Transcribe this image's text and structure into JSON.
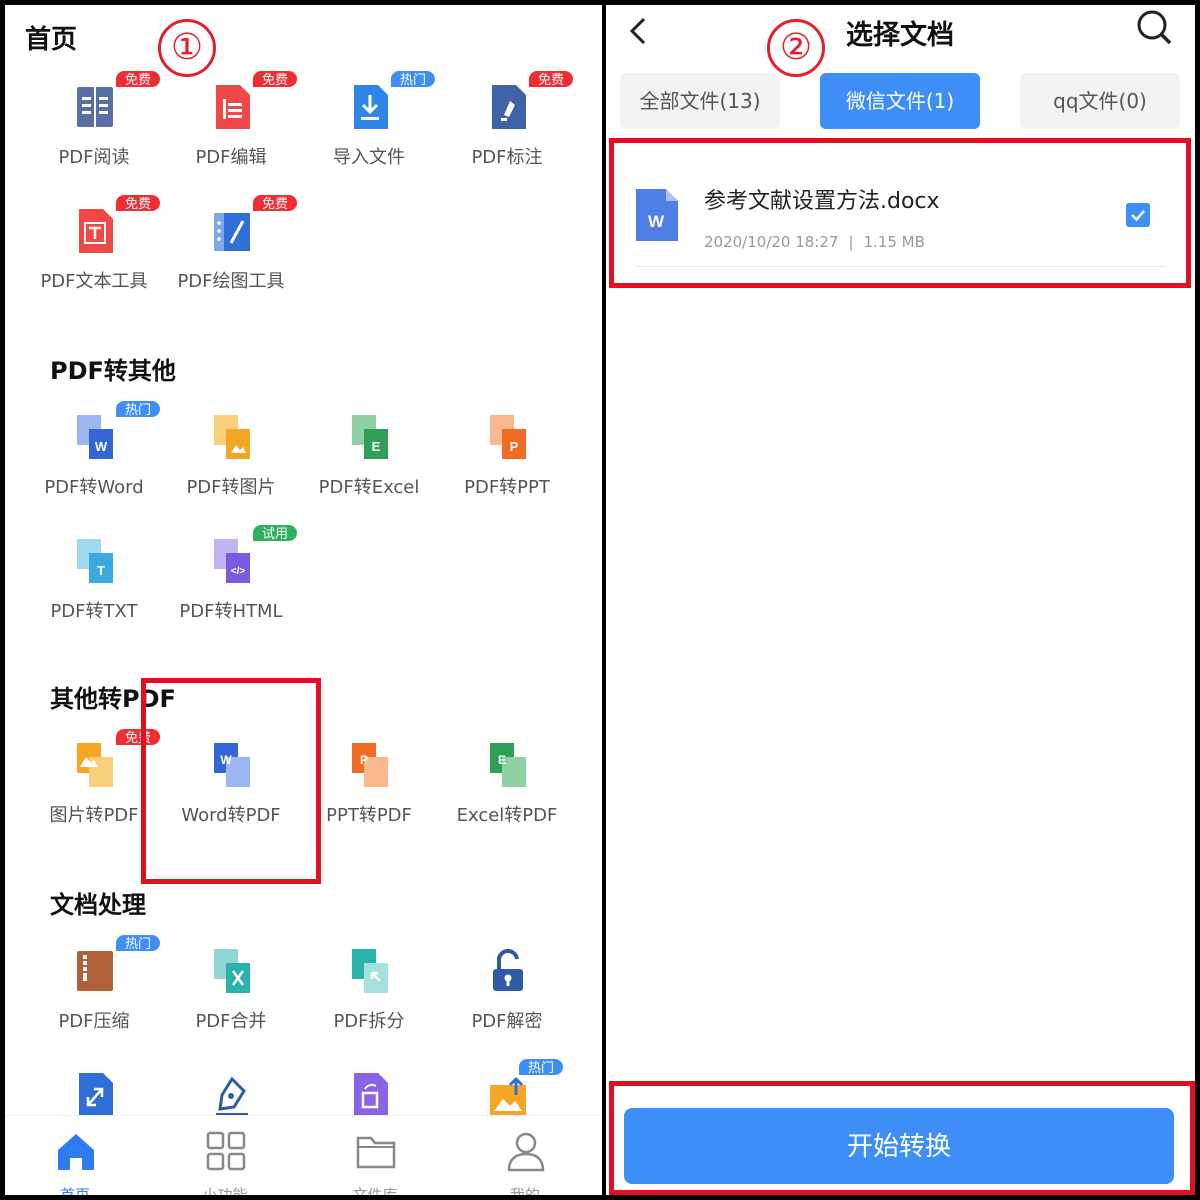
{
  "home": {
    "title": "首页",
    "step_marker": "①",
    "tools": [
      {
        "label": "PDF阅读",
        "icon": "pdf-read-icon",
        "badge": "免费"
      },
      {
        "label": "PDF编辑",
        "icon": "pdf-edit-icon",
        "badge": "免费"
      },
      {
        "label": "导入文件",
        "icon": "import-file-icon",
        "badge": "热门"
      },
      {
        "label": "PDF标注",
        "icon": "pdf-annotate-icon",
        "badge": "免费"
      },
      {
        "label": "PDF文本工具",
        "icon": "pdf-text-tool-icon",
        "badge": "免费"
      },
      {
        "label": "PDF绘图工具",
        "icon": "pdf-draw-tool-icon",
        "badge": "免费"
      }
    ],
    "sections": [
      {
        "title": "PDF转其他",
        "items": [
          {
            "label": "PDF转Word",
            "icon": "pdf-to-word-icon",
            "badge": "热门"
          },
          {
            "label": "PDF转图片",
            "icon": "pdf-to-image-icon"
          },
          {
            "label": "PDF转Excel",
            "icon": "pdf-to-excel-icon"
          },
          {
            "label": "PDF转PPT",
            "icon": "pdf-to-ppt-icon"
          },
          {
            "label": "PDF转TXT",
            "icon": "pdf-to-txt-icon"
          },
          {
            "label": "PDF转HTML",
            "icon": "pdf-to-html-icon",
            "badge": "试用"
          }
        ]
      },
      {
        "title": "其他转PDF",
        "items": [
          {
            "label": "图片转PDF",
            "icon": "image-to-pdf-icon",
            "badge": "免费"
          },
          {
            "label": "Word转PDF",
            "icon": "word-to-pdf-icon"
          },
          {
            "label": "PPT转PDF",
            "icon": "ppt-to-pdf-icon"
          },
          {
            "label": "Excel转PDF",
            "icon": "excel-to-pdf-icon"
          }
        ]
      },
      {
        "title": "文档处理",
        "items": [
          {
            "label": "PDF压缩",
            "icon": "pdf-compress-icon",
            "badge": "热门"
          },
          {
            "label": "PDF合并",
            "icon": "pdf-merge-icon"
          },
          {
            "label": "PDF拆分",
            "icon": "pdf-split-icon"
          },
          {
            "label": "PDF解密",
            "icon": "pdf-decrypt-icon"
          }
        ]
      }
    ],
    "bottom_nav": [
      {
        "label": "首页",
        "icon": "home-icon",
        "active": true
      },
      {
        "label": "小功能",
        "icon": "grid-icon"
      },
      {
        "label": "文件库",
        "icon": "folder-icon"
      },
      {
        "label": "我的",
        "icon": "user-icon"
      }
    ]
  },
  "select_doc": {
    "title": "选择文档",
    "step_marker": "②",
    "tabs": [
      {
        "label": "全部文件(13)"
      },
      {
        "label": "微信文件(1)",
        "active": true
      },
      {
        "label": "qq文件(0)"
      }
    ],
    "file": {
      "name": "参考文献设置方法.docx",
      "date": "2020/10/20 18:27",
      "separator": "|",
      "size": "1.15 MB",
      "checked": true
    },
    "convert_button": "开始转换"
  },
  "colors": {
    "accent_blue": "#3d8ef7",
    "highlight_red": "#e00f22",
    "badge_red": "#f12d33",
    "badge_blue": "#3f8ef5",
    "badge_green": "#2fb05c"
  }
}
